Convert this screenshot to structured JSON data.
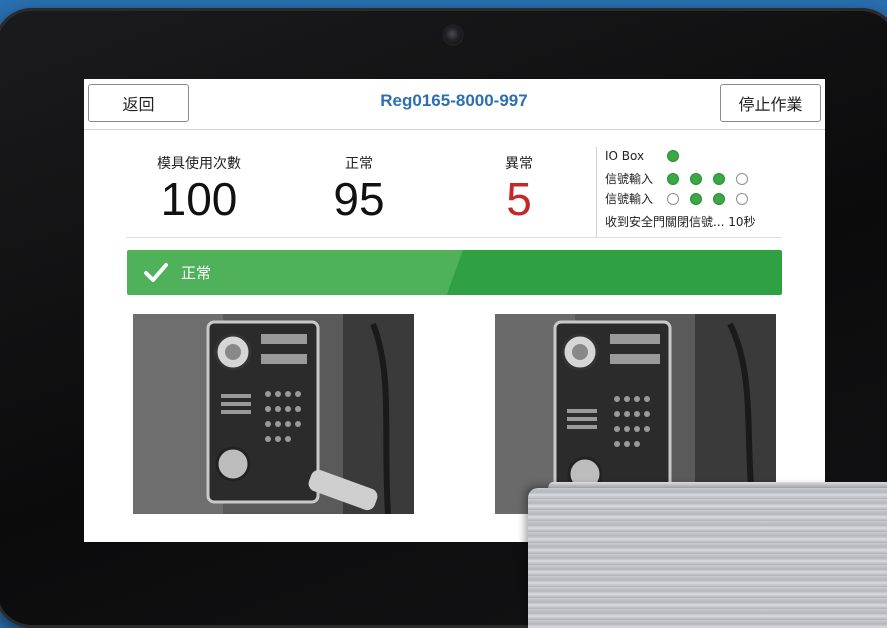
{
  "header": {
    "back_label": "返回",
    "title": "Reg0165-8000-997",
    "stop_label": "停止作業"
  },
  "stats": {
    "mold_uses_label": "模具使用次數",
    "mold_uses_value": "100",
    "normal_label": "正常",
    "normal_value": "95",
    "abnormal_label": "異常",
    "abnormal_value": "5"
  },
  "io": {
    "box_label": "IO Box",
    "box_led": "on",
    "input1_label": "信號輸入",
    "input1_leds": [
      "on",
      "on",
      "on",
      "off"
    ],
    "input2_label": "信號輸入",
    "input2_leds": [
      "off",
      "on",
      "on",
      "off"
    ],
    "message": "收到安全門關閉信號... 10秒"
  },
  "status": {
    "icon": "check-icon",
    "text": "正常"
  },
  "colors": {
    "accent": "#2d6fb0",
    "ok_green": "#39a845",
    "alert_red": "#c62828"
  }
}
